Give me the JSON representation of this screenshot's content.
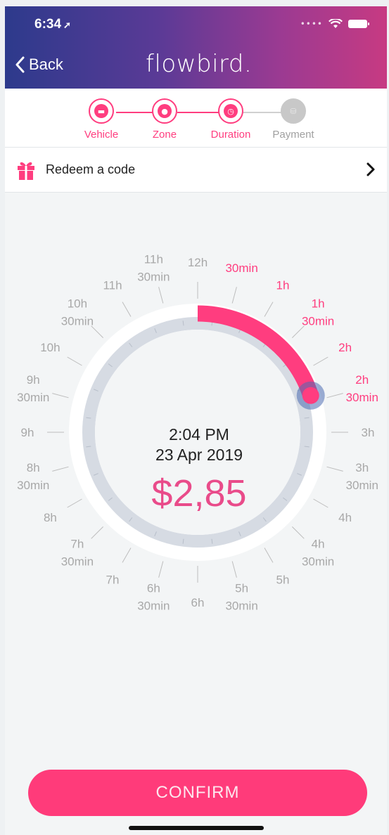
{
  "status": {
    "time": "6:34"
  },
  "header": {
    "back_label": "Back",
    "brand": "flowbird."
  },
  "steps": [
    {
      "label": "Vehicle",
      "active": true
    },
    {
      "label": "Zone",
      "active": true
    },
    {
      "label": "Duration",
      "active": true
    },
    {
      "label": "Payment",
      "active": false
    }
  ],
  "redeem": {
    "label": "Redeem a code"
  },
  "dial": {
    "time": "2:04 PM",
    "date": "23 Apr 2019",
    "price": "$2,85",
    "selected_fraction": 0.2,
    "labels": [
      {
        "lines": [
          "30min"
        ],
        "active": true
      },
      {
        "lines": [
          "1h"
        ],
        "active": true
      },
      {
        "lines": [
          "1h",
          "30min"
        ],
        "active": true
      },
      {
        "lines": [
          "2h"
        ],
        "active": true
      },
      {
        "lines": [
          "2h",
          "30min"
        ],
        "active": true
      },
      {
        "lines": [
          "3h"
        ],
        "active": false
      },
      {
        "lines": [
          "3h",
          "30min"
        ],
        "active": false
      },
      {
        "lines": [
          "4h"
        ],
        "active": false
      },
      {
        "lines": [
          "4h",
          "30min"
        ],
        "active": false
      },
      {
        "lines": [
          "5h"
        ],
        "active": false
      },
      {
        "lines": [
          "5h",
          "30min"
        ],
        "active": false
      },
      {
        "lines": [
          "6h"
        ],
        "active": false
      },
      {
        "lines": [
          "6h",
          "30min"
        ],
        "active": false
      },
      {
        "lines": [
          "7h"
        ],
        "active": false
      },
      {
        "lines": [
          "7h",
          "30min"
        ],
        "active": false
      },
      {
        "lines": [
          "8h"
        ],
        "active": false
      },
      {
        "lines": [
          "8h",
          "30min"
        ],
        "active": false
      },
      {
        "lines": [
          "9h"
        ],
        "active": false
      },
      {
        "lines": [
          "9h",
          "30min"
        ],
        "active": false
      },
      {
        "lines": [
          "10h"
        ],
        "active": false
      },
      {
        "lines": [
          "10h",
          "30min"
        ],
        "active": false
      },
      {
        "lines": [
          "11h"
        ],
        "active": false
      },
      {
        "lines": [
          "11h",
          "30min"
        ],
        "active": false
      },
      {
        "lines": [
          "12h"
        ],
        "active": false
      }
    ]
  },
  "confirm": {
    "label": "CONFIRM"
  },
  "colors": {
    "accent": "#ff3d7f",
    "knob": "#4d6bb3",
    "inactive_label": "#a8a8a8",
    "inner_ring": "#d6dbe3"
  }
}
